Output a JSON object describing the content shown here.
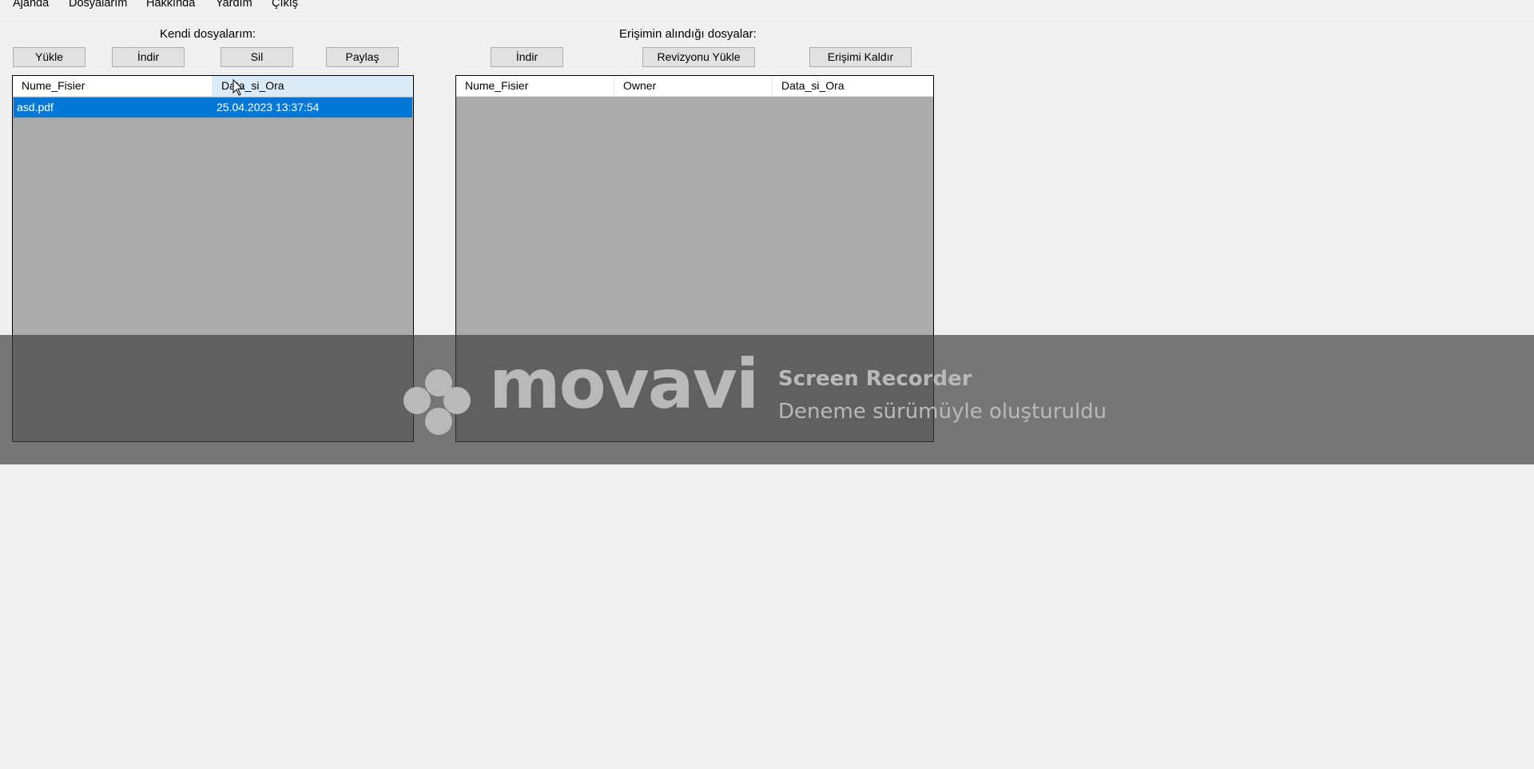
{
  "menu": {
    "items": [
      "Ajanda",
      "Dosyalarım",
      "Hakkında",
      "Yardım",
      "Çıkış"
    ]
  },
  "own_files": {
    "title": "Kendi dosyalarım:",
    "buttons": {
      "upload": "Yükle",
      "download": "İndir",
      "delete": "Sil",
      "share": "Paylaş"
    },
    "columns": [
      "Nume_Fisier",
      "Data_si_Ora"
    ],
    "rows": [
      {
        "name": "asd.pdf",
        "datetime": "25.04.2023 13:37:54",
        "selected": true
      }
    ]
  },
  "shared_files": {
    "title": "Erişimin alındığı dosyalar:",
    "buttons": {
      "download": "İndir",
      "upload_revision": "Revizyonu Yükle",
      "remove_access": "Erişimi Kaldır"
    },
    "columns": [
      "Nume_Fisier",
      "Owner",
      "Data_si_Ora"
    ],
    "rows": []
  },
  "watermark": {
    "brand": "movavi",
    "product": "Screen Recorder",
    "note": "Deneme sürümüyle oluşturuldu"
  },
  "colors": {
    "selection": "#0078d7",
    "list_background": "#ababab",
    "header_hover": "#d9ebf9",
    "window_background": "#f0f0f0"
  }
}
